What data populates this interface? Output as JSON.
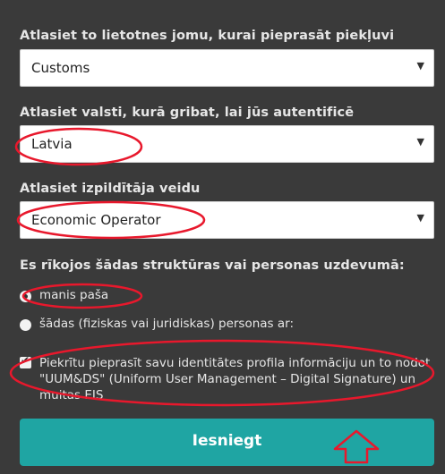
{
  "form": {
    "app_domain_label": "Atlasiet to lietotnes jomu, kurai pieprasāt piekļuvi",
    "app_domain_value": "Customs",
    "country_label": "Atlasiet valsti, kurā gribat, lai jūs autentificē",
    "country_value": "Latvia",
    "actor_label": "Atlasiet izpildītāja veidu",
    "actor_value": "Economic Operator",
    "acting_label": "Es rīkojos šādas struktūras vai personas uzdevumā:",
    "radio_self": "manis paša",
    "radio_other": "šādas (fiziskas vai juridiskas) personas ar:",
    "consent_text": "Piekrītu pieprasīt savu identitātes profila informāciju un to nodot \"UUM&DS\" (Uniform User Management – Digital Signature) un muitas EIS",
    "consent_checked": true,
    "submit_label": "Iesniegt"
  },
  "icons": {
    "select_caret": "chevron-down-icon",
    "annotation_arrow": "arrow-up-icon"
  },
  "colors": {
    "panel_bg": "#3a3a3a",
    "submit_bg": "#1fa5a3",
    "annotation": "#e8182c"
  }
}
